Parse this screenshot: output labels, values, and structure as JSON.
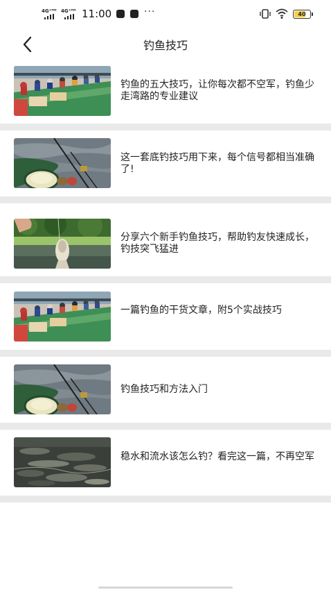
{
  "status_bar": {
    "network_1": "4G⁺ᴴᴰ",
    "network_2": "4G⁺ᴴᴰ",
    "time": "11:00",
    "more": "···",
    "battery": "40"
  },
  "header": {
    "title": "钓鱼技巧"
  },
  "articles": [
    {
      "title": "钓鱼的五大技巧，让你每次都不空军，钓鱼少走湾路的专业建议"
    },
    {
      "title": "这一套底钓技巧用下来，每个信号都相当准确了!"
    },
    {
      "title": "分享六个新手钓鱼技巧，帮助钓友快速成长，钓技突飞猛进"
    },
    {
      "title": "一篇钓鱼的干货文章，附5个实战技巧"
    },
    {
      "title": "钓鱼技巧和方法入门"
    },
    {
      "title": "稳水和流水该怎么钓？看完这一篇，不再空军"
    }
  ]
}
